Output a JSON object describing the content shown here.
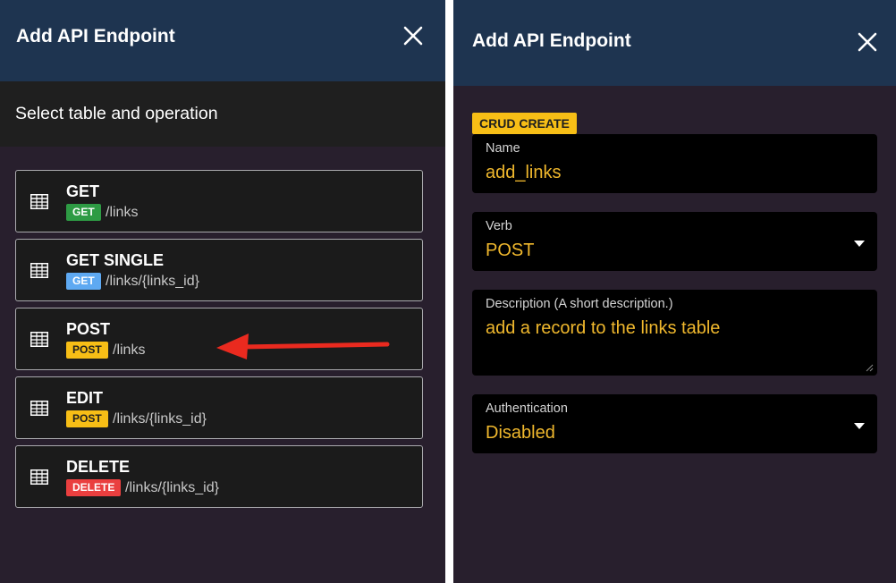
{
  "left": {
    "header": {
      "title": "Add API Endpoint"
    },
    "subheader": {
      "text": "Select table and operation"
    },
    "operations": [
      {
        "title": "GET",
        "badge": "GET",
        "badge_color": "#2e9b44",
        "badge_text_color": "#ffffff",
        "path": "/links"
      },
      {
        "title": "GET SINGLE",
        "badge": "GET",
        "badge_color": "#5ea9f2",
        "badge_text_color": "#ffffff",
        "path": "/links/{links_id}"
      },
      {
        "title": "POST",
        "badge": "POST",
        "badge_color": "#f7be16",
        "badge_text_color": "#1e1e1e",
        "path": "/links"
      },
      {
        "title": "EDIT",
        "badge": "POST",
        "badge_color": "#f7be16",
        "badge_text_color": "#1e1e1e",
        "path": "/links/{links_id}"
      },
      {
        "title": "DELETE",
        "badge": "DELETE",
        "badge_color": "#ea3f3f",
        "badge_text_color": "#ffffff",
        "path": "/links/{links_id}"
      }
    ],
    "annotation": {
      "icon": "red-arrow-icon",
      "color": "#ea2a1f"
    }
  },
  "right": {
    "header": {
      "title": "Add API Endpoint"
    },
    "crud_badge": "CRUD CREATE",
    "name": {
      "label": "Name",
      "value": "add_links"
    },
    "verb": {
      "label": "Verb",
      "value": "POST"
    },
    "description": {
      "label": "Description (A short description.)",
      "value": "add a record to the links table"
    },
    "authentication": {
      "label": "Authentication",
      "value": "Disabled"
    }
  },
  "colors": {
    "header_bg": "#1e3450",
    "panel_bg": "#281f2d",
    "accent_value": "#f0b82d",
    "field_bg": "#000000"
  }
}
